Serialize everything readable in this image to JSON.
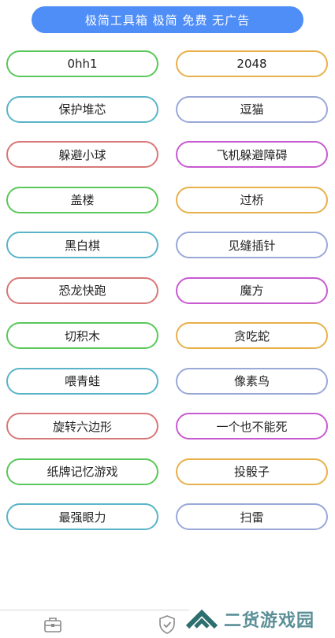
{
  "header": {
    "title": "极简工具箱 极简 免费 无广告"
  },
  "games": [
    {
      "label": "0hh1",
      "color": "#5ac85a"
    },
    {
      "label": "2048",
      "color": "#e8b04a"
    },
    {
      "label": "保护堆芯",
      "color": "#5ab4c8"
    },
    {
      "label": "逗猫",
      "color": "#9aa8d8"
    },
    {
      "label": "躲避小球",
      "color": "#d87878"
    },
    {
      "label": "飞机躲避障碍",
      "color": "#c85ad0"
    },
    {
      "label": "盖楼",
      "color": "#5ac85a"
    },
    {
      "label": "过桥",
      "color": "#e8b04a"
    },
    {
      "label": "黑白棋",
      "color": "#5ab4c8"
    },
    {
      "label": "见缝插针",
      "color": "#9aa8d8"
    },
    {
      "label": "恐龙快跑",
      "color": "#d87878"
    },
    {
      "label": "魔方",
      "color": "#c85ad0"
    },
    {
      "label": "切积木",
      "color": "#5ac85a"
    },
    {
      "label": "贪吃蛇",
      "color": "#e8b04a"
    },
    {
      "label": "喂青蛙",
      "color": "#5ab4c8"
    },
    {
      "label": "像素鸟",
      "color": "#9aa8d8"
    },
    {
      "label": "旋转六边形",
      "color": "#d87878"
    },
    {
      "label": "一个也不能死",
      "color": "#c85ad0"
    },
    {
      "label": "纸牌记忆游戏",
      "color": "#5ac85a"
    },
    {
      "label": "投骰子",
      "color": "#e8b04a"
    },
    {
      "label": "最强眼力",
      "color": "#5ab4c8"
    },
    {
      "label": "扫雷",
      "color": "#9aa8d8"
    }
  ],
  "bottom_nav": {
    "items": [
      {
        "icon": "toolbox-icon"
      },
      {
        "icon": "shield-check-icon"
      }
    ]
  },
  "watermark": {
    "text": "二货游戏园",
    "logo_color": "#2d6f6f"
  }
}
